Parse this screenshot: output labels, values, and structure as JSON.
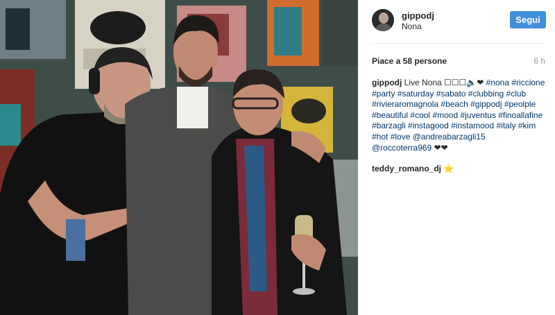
{
  "post": {
    "username": "gippodj",
    "location": "Nona",
    "follow_label": "Segui",
    "likes_text": "Piace a 58 persone",
    "time_ago": "6 h"
  },
  "caption": {
    "username": "gippodj",
    "text_prefix": "Live Nona ☐☐☐🔉❤",
    "tags": [
      "#nona",
      "#riccione",
      "#party",
      "#saturday",
      "#sabato",
      "#clubbing",
      "#club",
      "#rivieraromagnola",
      "#beach",
      "#gippodj",
      "#peolple",
      "#beautiful",
      "#cool",
      "#mood",
      "#juventus",
      "#finoallafine",
      "#barzagli",
      "#instagood",
      "#instamood",
      "#italy",
      "#kim",
      "#hot",
      "#love",
      "@andreabarzagli15",
      "@roccoterra969"
    ],
    "suffix": "❤❤"
  },
  "comment": {
    "username": "teddy_romano_dj",
    "emoji": "⭐"
  },
  "icons": {
    "avatar": "profile-avatar",
    "star": "star-emoji"
  },
  "colors": {
    "follow_button": "#4090db",
    "hashtag": "#003569",
    "text": "#262626",
    "muted": "#999999"
  }
}
